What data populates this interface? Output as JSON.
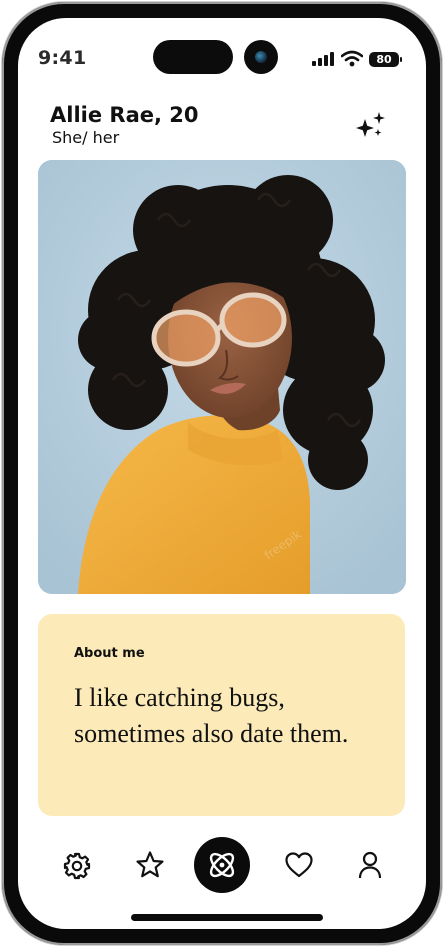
{
  "status_bar": {
    "time": "9:41",
    "battery": "80"
  },
  "profile": {
    "name_age": "Allie Rae, 20",
    "pronouns": "She/ her"
  },
  "about": {
    "heading": "About me",
    "text": "I like catching bugs, sometimes also date them."
  },
  "nav": {
    "items": [
      {
        "icon": "gear-icon"
      },
      {
        "icon": "star-icon"
      },
      {
        "icon": "atom-icon",
        "active": true
      },
      {
        "icon": "heart-icon"
      },
      {
        "icon": "person-icon"
      }
    ]
  },
  "colors": {
    "accent": "#0b0b0b",
    "about_card_bg": "#fcebb9",
    "photo_bg": "#b6cedd"
  }
}
